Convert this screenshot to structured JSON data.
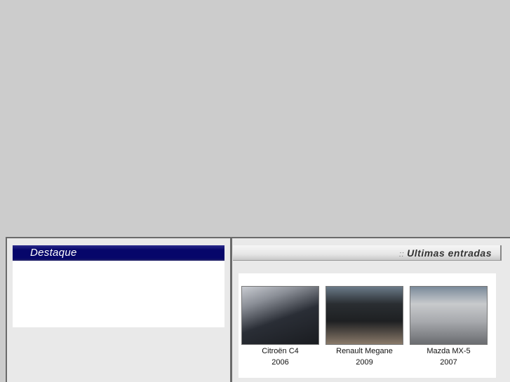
{
  "featured": {
    "title": "Destaque"
  },
  "latest": {
    "separator": "::",
    "title": "Ultimas entradas",
    "cars": [
      {
        "name": "Citroën C4",
        "year": "2006",
        "color": "#2a2e36"
      },
      {
        "name": "Renault Megane",
        "year": "2009",
        "color": "#1e2022"
      },
      {
        "name": "Mazda MX-5",
        "year": "2007",
        "color": "#a8aaae"
      }
    ]
  }
}
